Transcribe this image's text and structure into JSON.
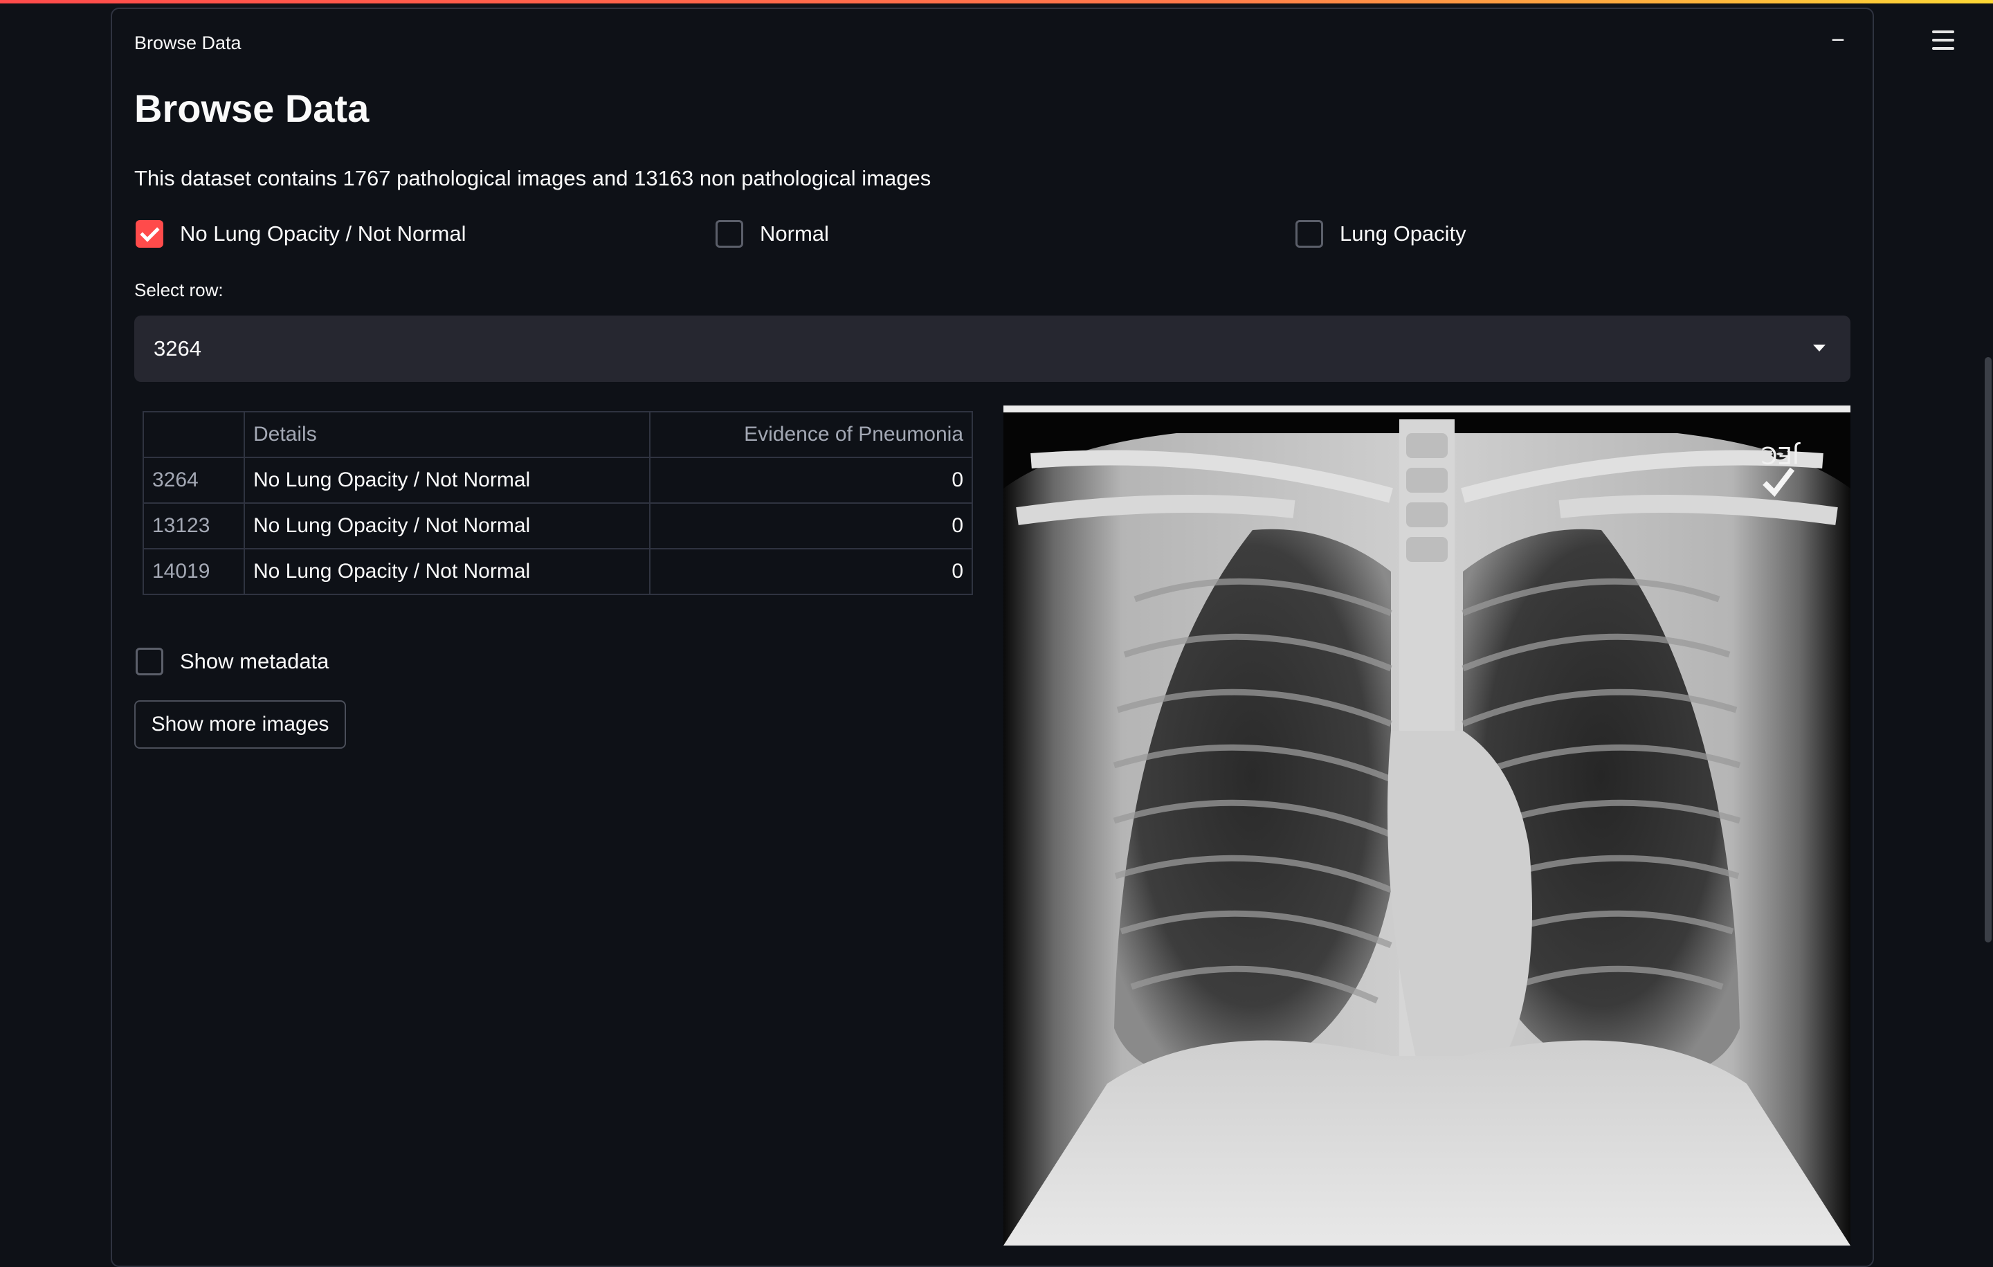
{
  "expander": {
    "header": "Browse Data",
    "collapse_glyph": "−"
  },
  "page": {
    "title": "Browse Data",
    "description": "This dataset contains 1767 pathological images and 13163 non pathological images"
  },
  "filters": [
    {
      "label": "No Lung Opacity / Not Normal",
      "checked": true
    },
    {
      "label": "Normal",
      "checked": false
    },
    {
      "label": "Lung Opacity",
      "checked": false
    }
  ],
  "select_row": {
    "label": "Select row:",
    "value": "3264"
  },
  "table": {
    "columns": [
      "",
      "Details",
      "Evidence of Pneumonia"
    ],
    "rows": [
      {
        "index": "3264",
        "details": "No Lung Opacity / Not Normal",
        "evidence": "0"
      },
      {
        "index": "13123",
        "details": "No Lung Opacity / Not Normal",
        "evidence": "0"
      },
      {
        "index": "14019",
        "details": "No Lung Opacity / Not Normal",
        "evidence": "0"
      }
    ]
  },
  "show_metadata": {
    "label": "Show metadata",
    "checked": false
  },
  "show_more_button": "Show more images",
  "image": {
    "marker_text": "JEC"
  },
  "colors": {
    "accent": "#ff4b4b",
    "background": "#0e1117",
    "input_bg": "#262730"
  },
  "icons": {
    "menu": "hamburger-menu-icon",
    "dropdown": "caret-down-icon"
  }
}
